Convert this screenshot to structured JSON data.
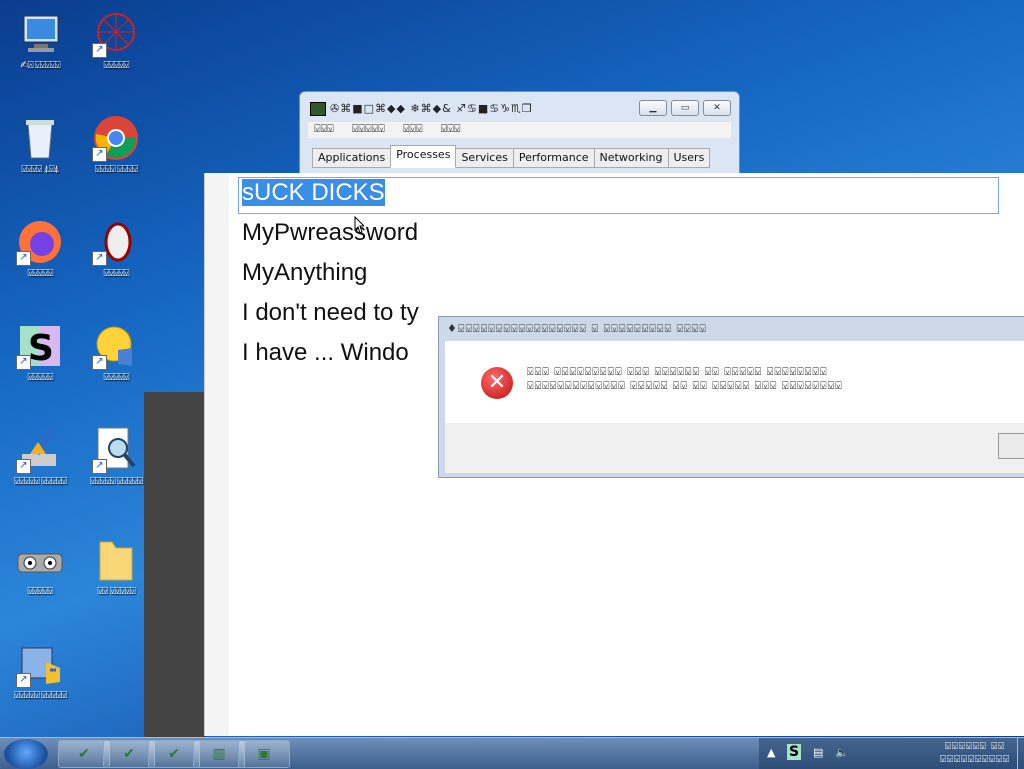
{
  "desktop": {
    "icons": [
      {
        "label": "✍⍓ ⍌⍌⍌⍌⍌",
        "name": "computer"
      },
      {
        "label": "⍌⍌⍌⍌⍌",
        "name": "network-graphic"
      },
      {
        "label": "⍌⍌⍌⍌ ⍋⍌⍋",
        "name": "recycle-bin"
      },
      {
        "label": "⍌⍌⍌⍌ ⍌⍌⍌⍌",
        "name": "chrome"
      },
      {
        "label": "⍌⍌⍌⍌⍌",
        "name": "firefox"
      },
      {
        "label": "⍌⍌⍌⍌⍌",
        "name": "mouse-tool"
      },
      {
        "label": "⍌⍌⍌⍌⍌",
        "name": "s-app"
      },
      {
        "label": "⍌⍌⍌⍌⍌",
        "name": "emoji-app"
      },
      {
        "label": "⍌⍌⍌⍌⍌ ⍌⍌⍌⍌⍌",
        "name": "cleaner"
      },
      {
        "label": "⍌⍌⍌⍌⍌ ⍌⍌⍌⍌⍌",
        "name": "search-document"
      },
      {
        "label": "⍌⍌⍌⍌⍌",
        "name": "eyes-app"
      },
      {
        "label": "⍌⍌ ⍌⍌⍌⍌⍌",
        "name": "folder"
      },
      {
        "label": "⍌⍌⍌⍌⍌ ⍌⍌⍌⍌⍌",
        "name": "control-panel"
      }
    ]
  },
  "taskmgr": {
    "title": "✇⌘■□⌘◆◆ ❄⌘◆& ♐♋■♋♑♏❒",
    "menu": [
      "⍌⍌⍌",
      "⍌⍌⍌⍌⍌",
      "⍌⍌⍌",
      "⍌⍌⍌"
    ],
    "tabs": [
      "Applications",
      "Processes",
      "Services",
      "Performance",
      "Networking",
      "Users"
    ],
    "active_tab": "Processes"
  },
  "editor": {
    "lines": [
      "sUCK DICKS",
      "MyPwreassword",
      "MyAnything",
      "I don't need to ty",
      "I  have ... Windo"
    ]
  },
  "error_dialog": {
    "title": "♦⍌⍌⍌⍌⍌⍌⍌⍌⍌⍌⍌⍌⍌⍌⍌⍌⍌ ⍌ ⍌⍌⍌⍌⍌⍌⍌⍌⍌ ⍌⍌⍌⍌",
    "message_line1": "⍌⍌⍌ ⍌⍌⍌⍌⍌⍌⍌⍌⍌ ⍌⍌⍌ ⍌⍌⍌⍌⍌⍌ ⍌⍌ ⍌⍌⍌⍌⍌ ⍌⍌⍌⍌⍌⍌⍌⍌",
    "message_line2": "⍌⍌⍌⍌⍌⍌⍌⍌⍌⍌⍌⍌⍌ ⍌⍌⍌⍌⍌ ⍌⍌ ⍌⍌ ⍌⍌⍌⍌⍌ ⍌⍌⍌ ⍌⍌⍌⍌⍌⍌⍌⍌"
  },
  "taskbar": {
    "tray_app": "S",
    "clock_time": "⍌⍌⍌⍌⍌⍌ ⍌⍌",
    "clock_date": "⍌⍌⍌⍌⍌⍌⍌⍌⍌⍌"
  }
}
